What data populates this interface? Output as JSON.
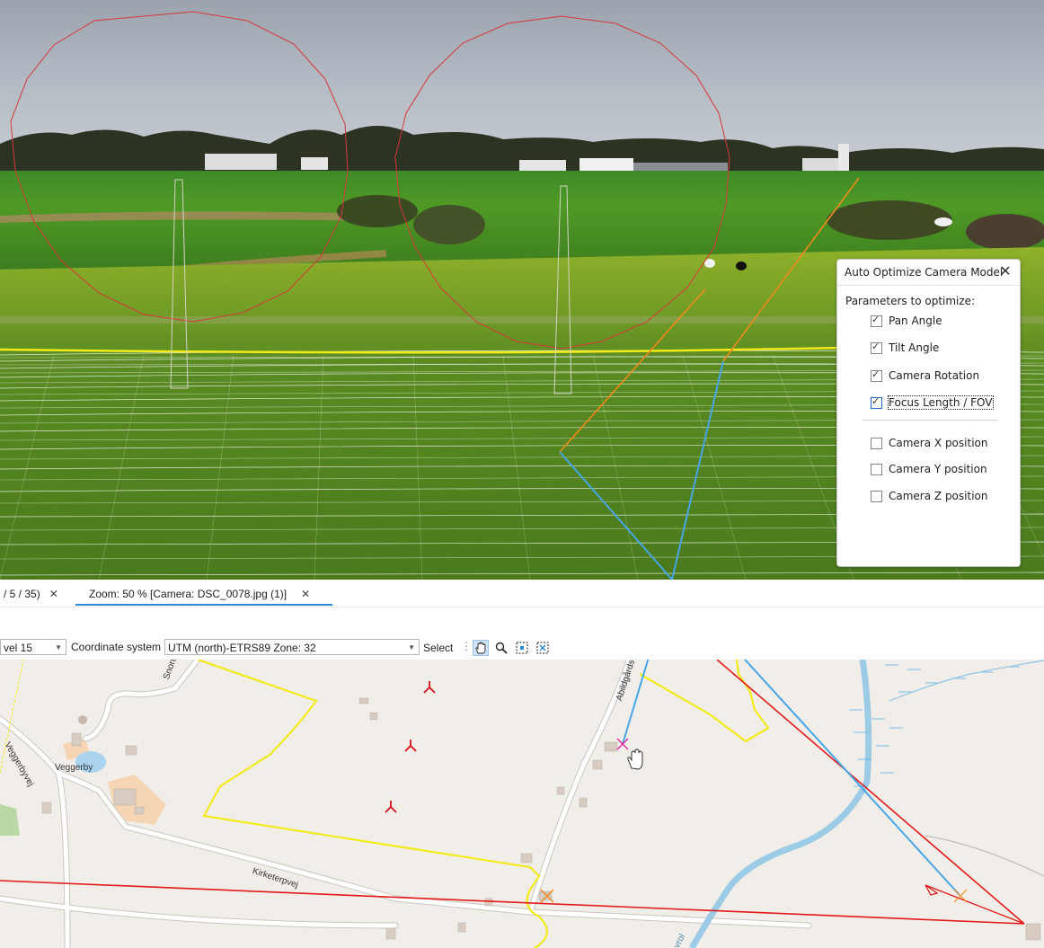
{
  "panel": {
    "title": "Auto Optimize Camera Model",
    "params_label": "Parameters to optimize:",
    "params": [
      {
        "label": "Pan Angle",
        "checked": true
      },
      {
        "label": "Tilt Angle",
        "checked": true
      },
      {
        "label": "Camera Rotation",
        "checked": true
      },
      {
        "label": "Focus Length / FOV",
        "checked": true,
        "focused": true
      },
      {
        "label": "Camera X position",
        "checked": false
      },
      {
        "label": "Camera Y position",
        "checked": false
      },
      {
        "label": "Camera Z position",
        "checked": false
      }
    ]
  },
  "tabs": [
    {
      "label": "/ 5 / 35)",
      "active": false
    },
    {
      "label": "Zoom: 50 % [Camera: DSC_0078.jpg (1)]",
      "active": true
    }
  ],
  "toolbar": {
    "level_value": "vel 15",
    "coord_label": "Coordinate system",
    "coord_value": "UTM (north)-ETRS89 Zone: 32",
    "select_label": "Select"
  },
  "map": {
    "labels": {
      "veggerby": "Veggerby",
      "veggerbyvej": "Veggerbyvej",
      "snorupgards": "Snorupgårds",
      "abildgards": "Abildgårds",
      "kirketerpvej": "Kirketerpvej",
      "river": "vrol"
    }
  },
  "colors": {
    "accent": "#2b8ad6",
    "boundary": "#f2ea1a",
    "sightline": "#e21a1a",
    "ray": "#46a6e6",
    "ray_upper": "#f08a1c"
  },
  "icons": [
    "close-icon",
    "pan-hand-icon",
    "zoom-icon",
    "select-rect-icon",
    "select-area-icon",
    "tower-marker-icon",
    "camera-marker-icon"
  ]
}
